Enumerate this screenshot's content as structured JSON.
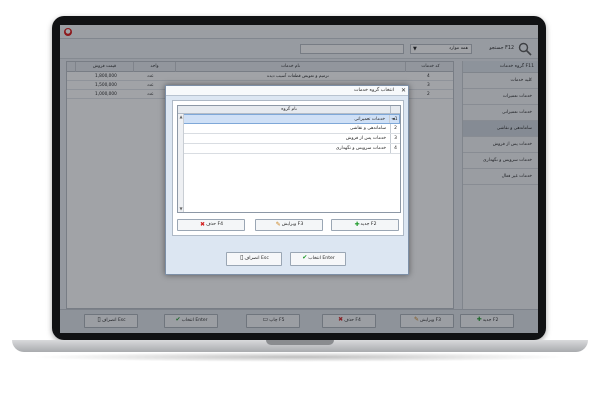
{
  "app": {
    "toolbar": {
      "search_label": "جستجو F12",
      "combo_value": "همه موارد",
      "combo_arrow": "▼"
    },
    "sidebar": {
      "header": "گروه خدمات F11",
      "items": [
        {
          "label": "کلیه خدمات"
        },
        {
          "label": "خدمات تعمیرات"
        },
        {
          "label": "خدمات تعمیراتی"
        },
        {
          "label": "ساماندهی و نقاشی"
        },
        {
          "label": "خدمات پس از فروش"
        },
        {
          "label": "خدمات سرویس و نگهداری"
        },
        {
          "label": "خدمات غیر فعال"
        }
      ]
    },
    "grid": {
      "columns": [
        "قیمت فروش",
        "واحد",
        "نام خدمات",
        "کد خدمات"
      ],
      "rows": [
        {
          "price": "1,800,000",
          "unit": "عدد",
          "name": "ترمیم و تعویض قطعات آسیب دیده",
          "code": "4"
        },
        {
          "price": "1,500,000",
          "unit": "عدد",
          "name": "",
          "code": "3"
        },
        {
          "price": "1,000,000",
          "unit": "عدد",
          "name": "",
          "code": "2"
        }
      ],
      "footer": "تعداد خدمات : 8"
    },
    "bottombar": {
      "new": "جدید F2",
      "edit": "ویرایش F3",
      "delete": "حذف F4",
      "print": "چاپ F5",
      "select": "انتخاب Enter",
      "cancel": "انصراف Esc"
    }
  },
  "modal": {
    "title": "انتخاب گروه خدمات",
    "close_glyph": "✕",
    "list_header": "نام گروه",
    "rows": [
      {
        "num": "1",
        "text": "خدمات تعمیراتی"
      },
      {
        "num": "2",
        "text": "ساماندهی و نقاشی"
      },
      {
        "num": "3",
        "text": "خدمات پس از فروش"
      },
      {
        "num": "4",
        "text": "خدمات سرویس و نگهداری"
      }
    ],
    "selected_marker": "◄",
    "buttons": {
      "new": "جدید F2",
      "edit": "ویرایش F3",
      "delete": "حذف F4"
    },
    "footer": {
      "select": "انتخاب Enter",
      "cancel": "انصراف Esc"
    }
  },
  "colors": {
    "accent_green": "#1e9a2a",
    "accent_red": "#d32020",
    "selection": "#cfe0f6"
  }
}
